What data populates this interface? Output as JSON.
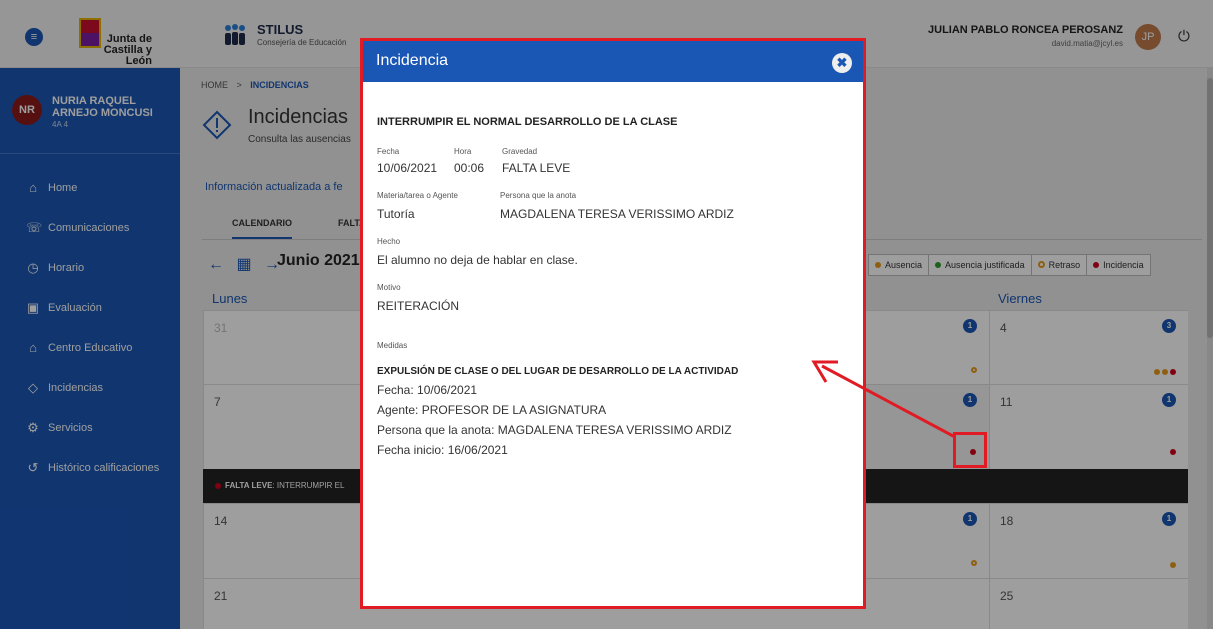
{
  "header": {
    "logo_text": "Junta de Castilla y León",
    "app_name": "STILUS",
    "app_subtitle": "Consejería de Educación",
    "user_name": "JULIAN PABLO RONCEA PEROSANZ",
    "user_email": "david.matia@jcyl.es",
    "user_initials": "JP"
  },
  "sidebar": {
    "student_initials": "NR",
    "student_name": "NURIA RAQUEL ARNEJO MONCUSI",
    "student_group": "4A 4",
    "items": [
      {
        "label": "Home",
        "icon": "home-icon"
      },
      {
        "label": "Comunicaciones",
        "icon": "chat-icon"
      },
      {
        "label": "Horario",
        "icon": "clock-icon"
      },
      {
        "label": "Evaluación",
        "icon": "grade-icon"
      },
      {
        "label": "Centro Educativo",
        "icon": "school-icon"
      },
      {
        "label": "Incidencias",
        "icon": "warning-diamond-icon"
      },
      {
        "label": "Servicios",
        "icon": "gear-icon"
      },
      {
        "label": "Histórico calificaciones",
        "icon": "history-icon"
      }
    ]
  },
  "main": {
    "breadcrumb_home": "HOME",
    "breadcrumb_sep": ">",
    "breadcrumb_current": "INCIDENCIAS",
    "title": "Incidencias",
    "subtitle": "Consulta las ausencias",
    "update_info": "Información actualizada a fe",
    "tabs": [
      "CALENDARIO",
      "FALTA"
    ],
    "month": "Junio 2021",
    "legend": [
      {
        "label": "Ausencia",
        "color": "#e59a1c"
      },
      {
        "label": "Ausencia justificada",
        "color": "#2e9e2e"
      },
      {
        "label": "Retraso",
        "color": "#e59a1c"
      },
      {
        "label": "Incidencia",
        "color": "#d0021b"
      }
    ],
    "day_headers": {
      "mon": "Lunes",
      "fri": "Viernes"
    },
    "weeks": [
      {
        "mon": "31",
        "fri": "4",
        "thu_count": "1",
        "fri_count": "3"
      },
      {
        "mon": "7",
        "fri": "11",
        "thu_count": "1",
        "fri_count": "1"
      },
      {
        "mon": "14",
        "fri": "18",
        "thu_count": "1",
        "fri_count": "1"
      },
      {
        "mon": "21",
        "fri": "25"
      }
    ],
    "incident_bar_label": "FALTA LEVE",
    "incident_bar_text": ": INTERRUMPIR EL"
  },
  "modal": {
    "title": "Incidencia",
    "close_icon": "close-icon",
    "heading": "INTERRUMPIR EL NORMAL DESARROLLO DE LA CLASE",
    "fecha_label": "Fecha",
    "fecha_value": "10/06/2021",
    "hora_label": "Hora",
    "hora_value": "00:06",
    "gravedad_label": "Gravedad",
    "gravedad_value": "FALTA LEVE",
    "materia_label": "Materia/tarea o Agente",
    "materia_value": "Tutoría",
    "persona_label": "Persona que la anota",
    "persona_value": "MAGDALENA TERESA VERISSIMO ARDIZ",
    "hecho_label": "Hecho",
    "hecho_value": "El alumno no deja de hablar en clase.",
    "motivo_label": "Motivo",
    "motivo_value": "REITERACIÓN",
    "medidas_label": "Medidas",
    "medida_title": "EXPULSIÓN DE CLASE O DEL LUGAR DE DESARROLLO DE LA ACTIVIDAD",
    "medida_lines": [
      "Fecha: 10/06/2021",
      "Agente: PROFESOR DE LA ASIGNATURA",
      "Persona que la anota: MAGDALENA TERESA VERISSIMO ARDIZ",
      "Fecha inicio: 16/06/2021"
    ]
  },
  "colors": {
    "primary": "#1a56b4",
    "annotation": "#e01b24",
    "incidencia": "#d0021b",
    "retraso": "#e59a1c"
  }
}
